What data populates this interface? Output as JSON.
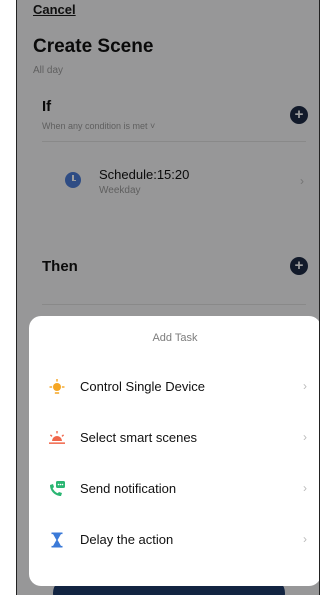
{
  "header": {
    "cancel_label": "Cancel",
    "title": "Create Scene",
    "subtitle": "All day"
  },
  "if_section": {
    "label": "If",
    "condition_hint": "When any condition is met ˅",
    "items": [
      {
        "title": "Schedule:15:20",
        "subtitle": "Weekday",
        "icon": "clock-icon"
      }
    ]
  },
  "then_section": {
    "label": "Then"
  },
  "add_task_sheet": {
    "title": "Add Task",
    "items": [
      {
        "label": "Control Single Device",
        "icon": "bulb-icon",
        "color": "#f5a623"
      },
      {
        "label": "Select smart scenes",
        "icon": "sunrise-icon",
        "color": "#f0664a"
      },
      {
        "label": "Send notification",
        "icon": "phone-message-icon",
        "color": "#2bb673"
      },
      {
        "label": "Delay the action",
        "icon": "hourglass-icon",
        "color": "#3b7ad8"
      }
    ]
  },
  "colors": {
    "accent_dark": "#1e2a44",
    "clock_blue": "#4b7bd6"
  }
}
